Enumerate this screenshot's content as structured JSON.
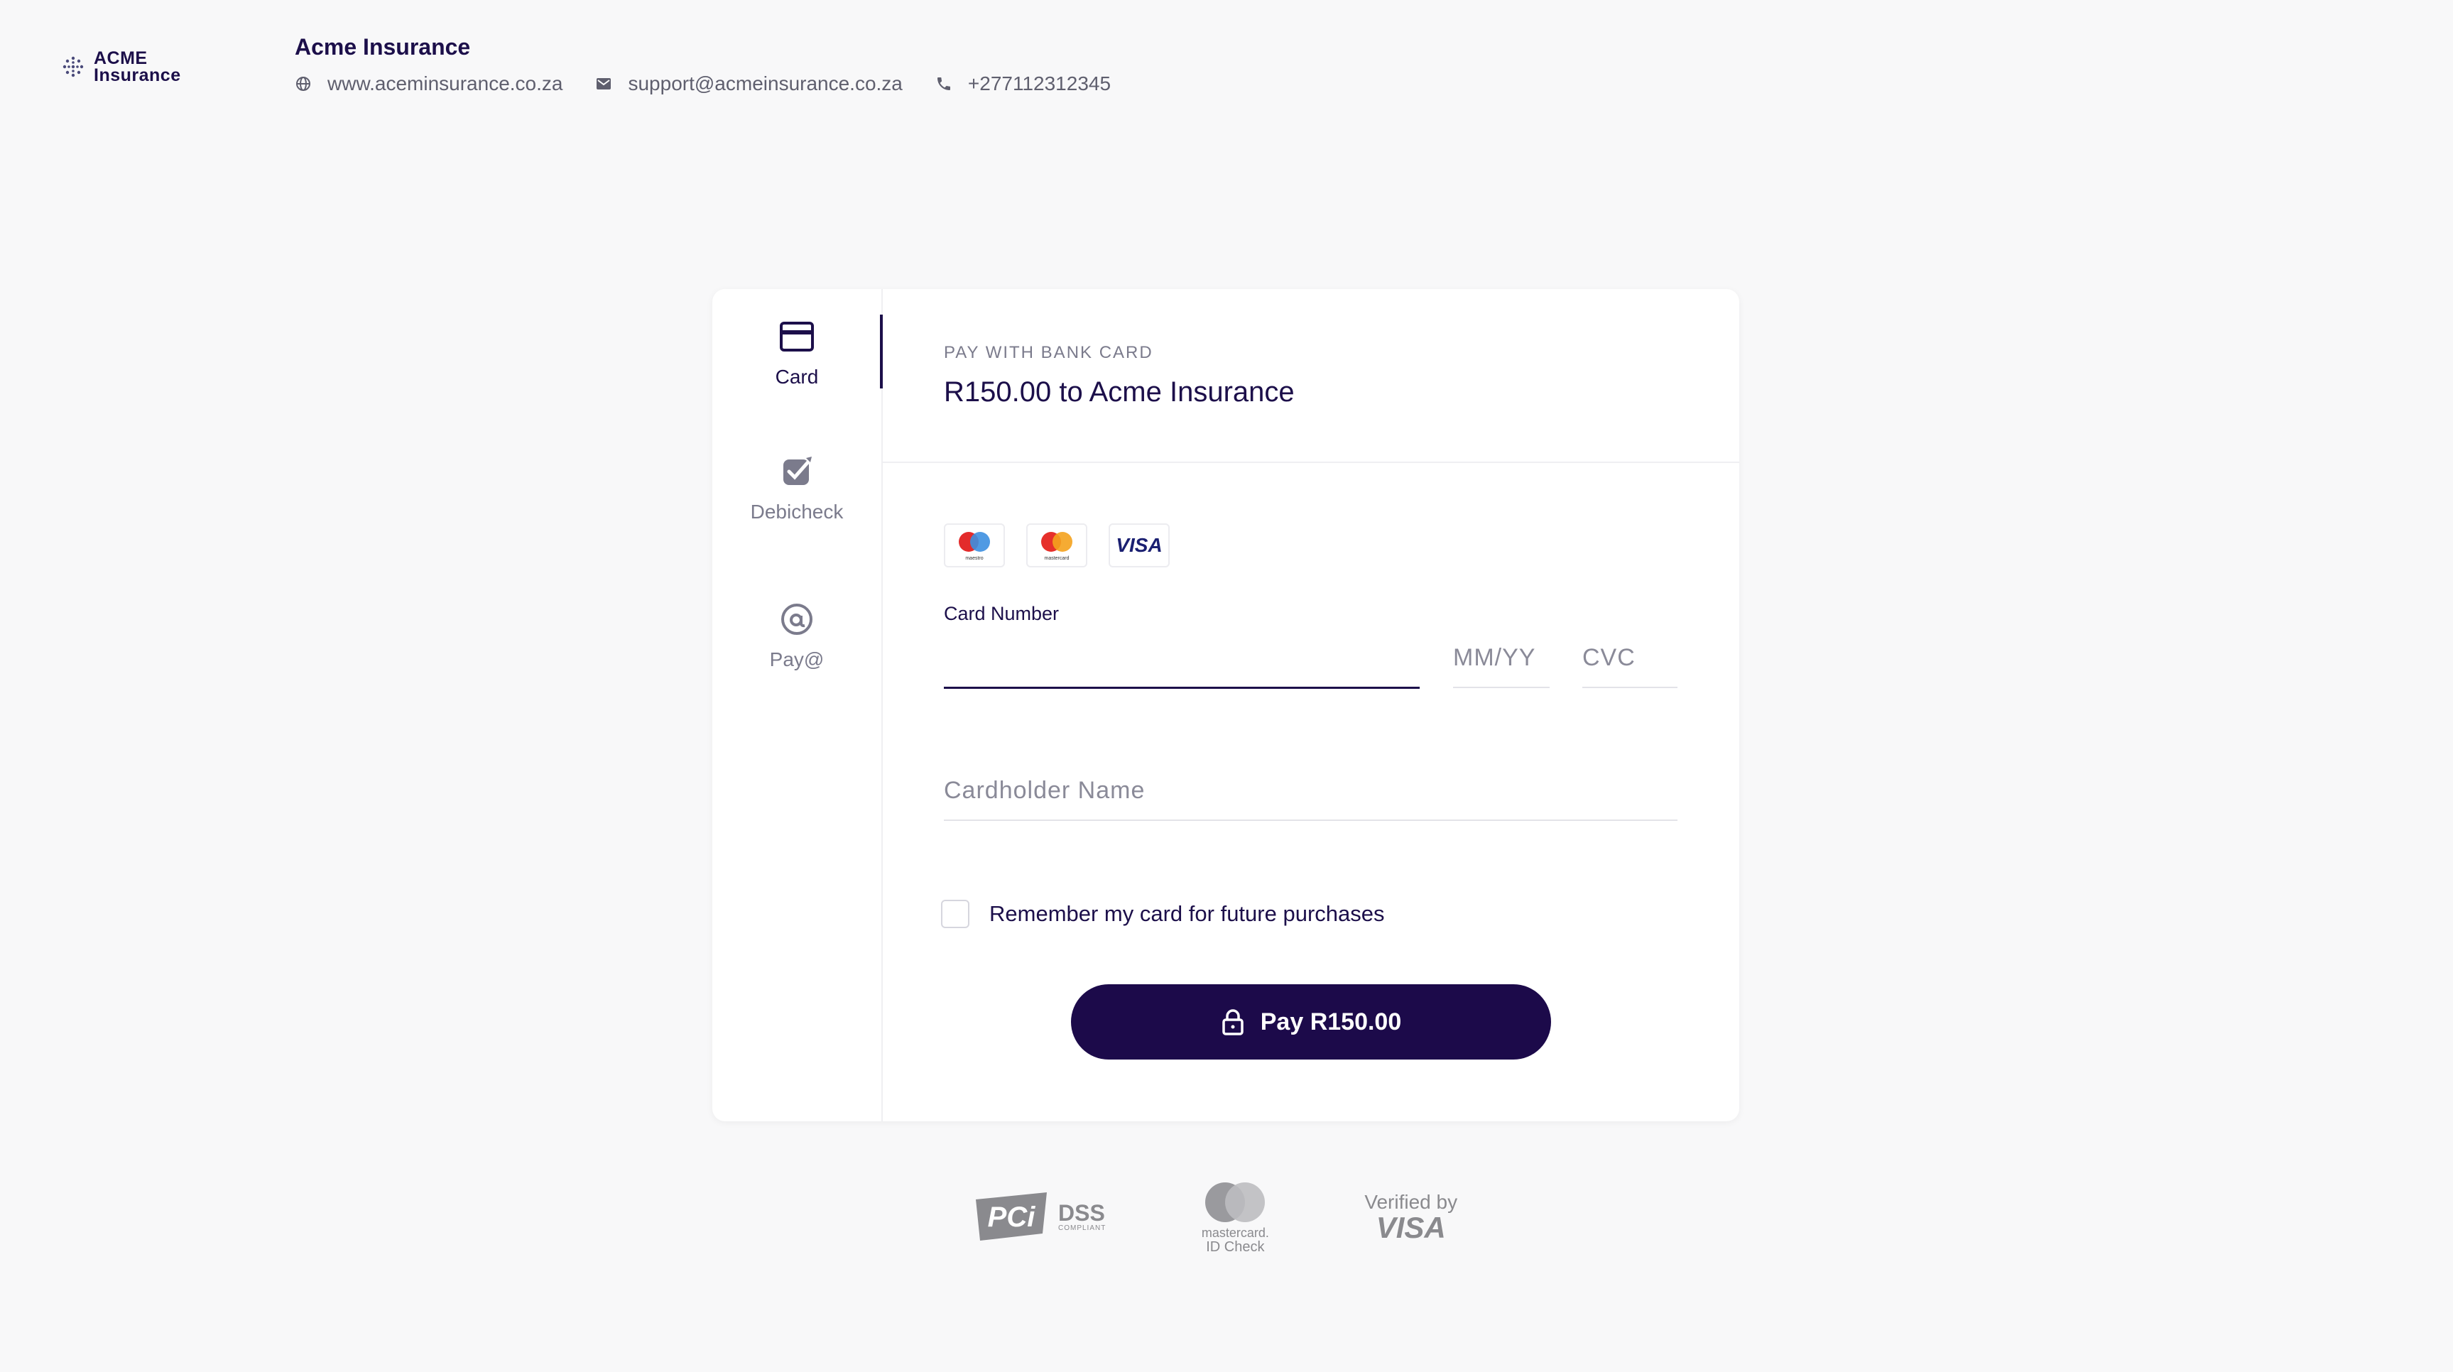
{
  "header": {
    "logo_line1": "ACME",
    "logo_line2": "Insurance",
    "merchant_name": "Acme Insurance",
    "website": "www.aceminsurance.co.za",
    "email": "support@acmeinsurance.co.za",
    "phone": "+277112312345"
  },
  "tabs": [
    {
      "label": "Card",
      "icon": "credit-card-icon",
      "active": true
    },
    {
      "label": "Debicheck",
      "icon": "checkmark-icon",
      "active": false
    },
    {
      "label": "Pay@",
      "icon": "at-icon",
      "active": false
    }
  ],
  "payment": {
    "method_label": "PAY WITH BANK CARD",
    "amount_line": "R150.00 to Acme Insurance",
    "brands": [
      "maestro",
      "mastercard",
      "VISA"
    ]
  },
  "form": {
    "card_number_label": "Card Number",
    "card_number_value": "",
    "expiry_placeholder": "MM/YY",
    "cvc_placeholder": "CVC",
    "holder_placeholder": "Cardholder Name",
    "remember_label": "Remember my card for future purchases",
    "remember_checked": false,
    "pay_button": "Pay R150.00"
  },
  "badges": {
    "pci_main": "PCi",
    "pci_dss": "DSS",
    "pci_compliant": "COMPLIANT",
    "mc_line1": "mastercard.",
    "mc_line2": "ID Check",
    "visa_line1": "Verified by",
    "visa_line2": "VISA"
  },
  "colors": {
    "primary": "#1c0a4a",
    "background": "#f8f8f9",
    "muted_text": "#7b7b8c"
  }
}
